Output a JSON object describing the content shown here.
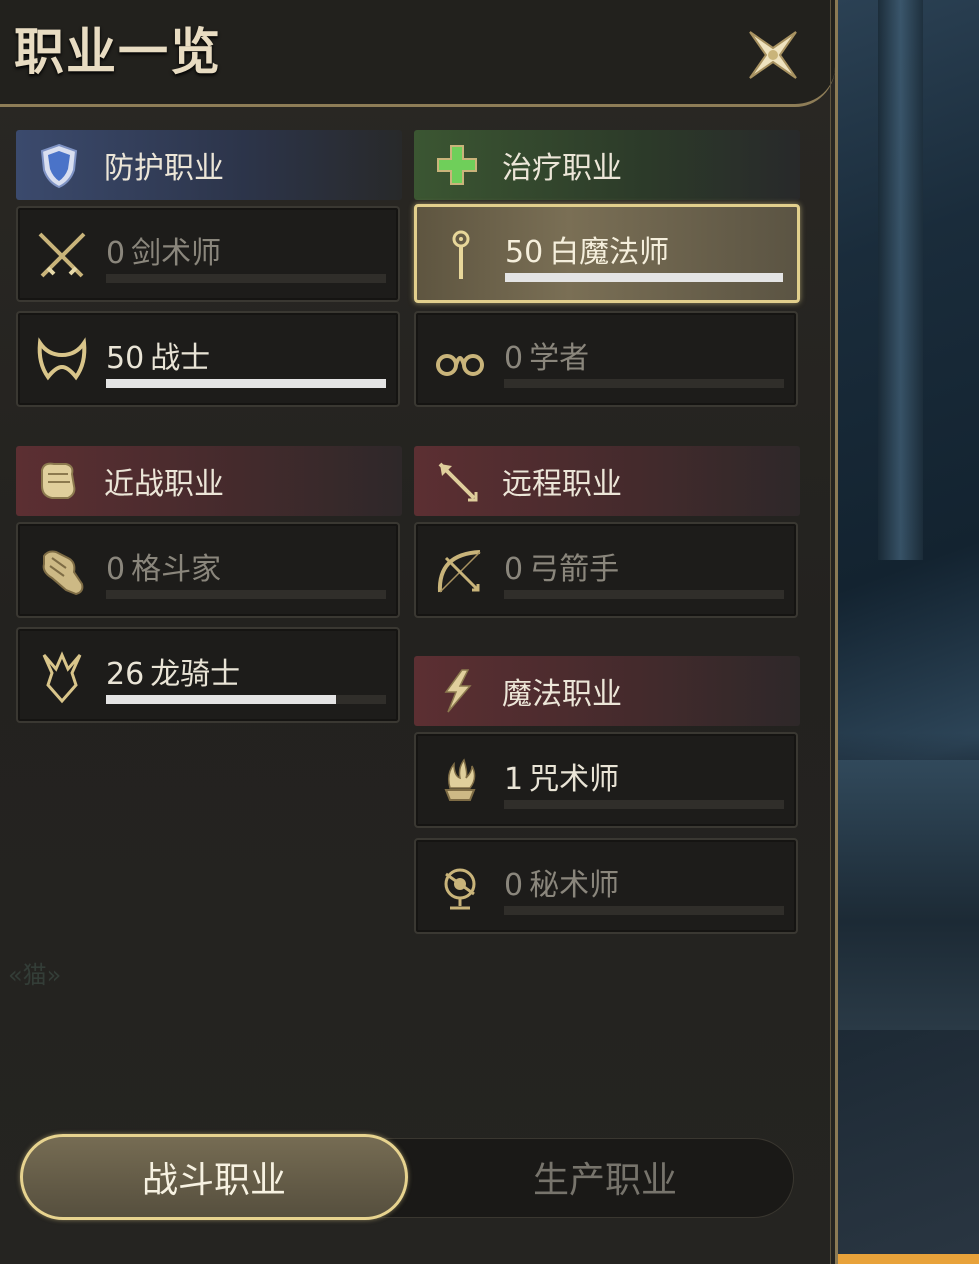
{
  "window": {
    "title": "职业一览"
  },
  "colors": {
    "gold": "#e2cf8c",
    "panel": "#23221f",
    "defense": "#3b4a6d",
    "heal": "#3b5632",
    "dps": "#5c2f32"
  },
  "categories": {
    "defense": {
      "label": "防护职业",
      "icon": "shield-icon"
    },
    "heal": {
      "label": "治疗职业",
      "icon": "green-cross-icon"
    },
    "melee": {
      "label": "近战职业",
      "icon": "fist-icon"
    },
    "ranged": {
      "label": "远程职业",
      "icon": "arrow-icon"
    },
    "magic": {
      "label": "魔法职业",
      "icon": "lightning-icon"
    }
  },
  "jobs": {
    "gladiator": {
      "level": "0",
      "name": "剑术师",
      "progress": 0,
      "icon": "crossed-swords-icon"
    },
    "warrior": {
      "level": "50",
      "name": "战士",
      "progress": 1.0,
      "icon": "warrior-horns-icon"
    },
    "white_mage": {
      "level": "50",
      "name": "白魔法师",
      "progress": 1.0,
      "icon": "staff-icon",
      "selected": true
    },
    "scholar": {
      "level": "0",
      "name": "学者",
      "progress": 0,
      "icon": "scholar-swirl-icon"
    },
    "pugilist": {
      "level": "0",
      "name": "格斗家",
      "progress": 0,
      "icon": "gauntlet-icon"
    },
    "dragoon": {
      "level": "26",
      "name": "龙骑士",
      "progress": 0.82,
      "icon": "dragon-helm-icon"
    },
    "archer": {
      "level": "0",
      "name": "弓箭手",
      "progress": 0,
      "icon": "bow-icon"
    },
    "thaumaturge": {
      "level": "1",
      "name": "咒术师",
      "progress": 0,
      "icon": "flame-brazier-icon"
    },
    "arcanist": {
      "level": "0",
      "name": "秘术师",
      "progress": 0,
      "icon": "astrolabe-icon"
    }
  },
  "tabs": {
    "combat": "战斗职业",
    "crafting": "生产职业"
  },
  "background_text": [
    "«猫»"
  ]
}
